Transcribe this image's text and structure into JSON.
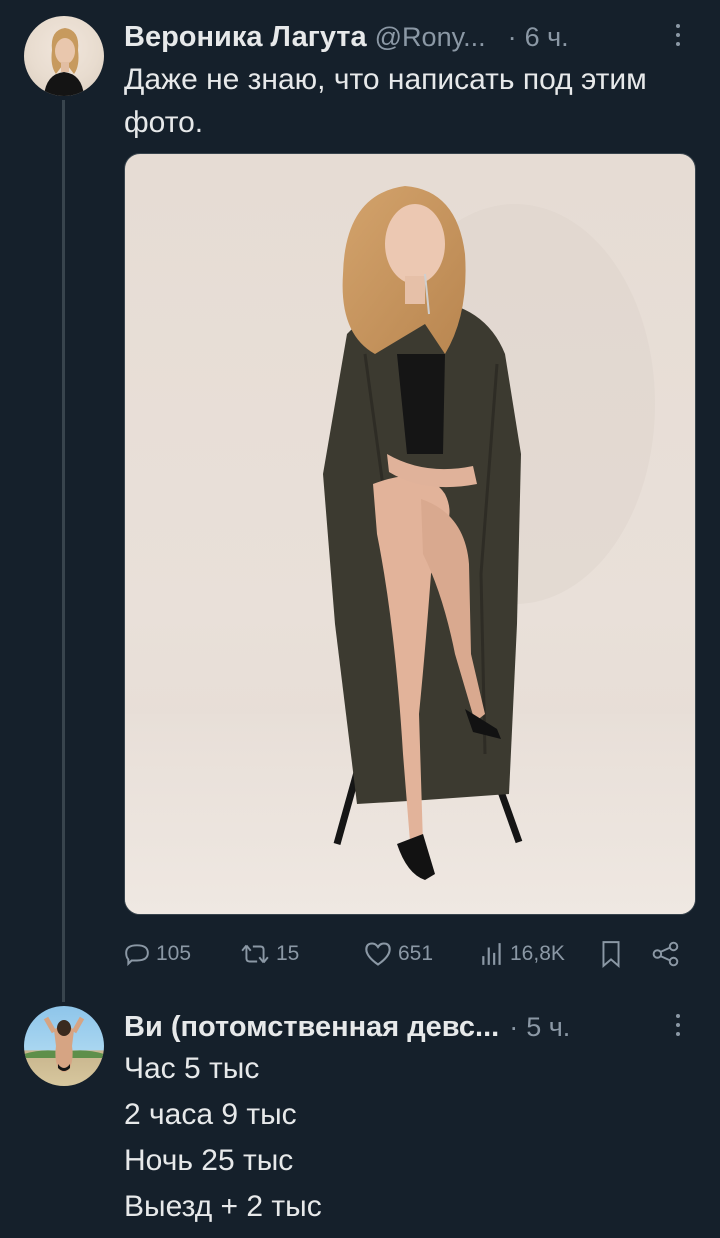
{
  "tweets": [
    {
      "author_name": "Вероника Лагута",
      "handle": "@Rony...",
      "separator": "·",
      "time": "6 ч.",
      "text": "Даже не знаю, что написать под этим фото.",
      "has_photo": true,
      "stats": {
        "replies": "105",
        "retweets": "15",
        "likes": "651",
        "views": "16,8K"
      }
    },
    {
      "author_name": "Ви (потомственная девс...",
      "separator": "·",
      "time": "5 ч.",
      "lines": [
        "Час 5 тыс",
        "2 часа 9 тыс",
        "Ночь 25 тыс",
        "Выезд + 2 тыс"
      ]
    }
  ],
  "icons": {
    "reply": "reply-icon",
    "retweet": "retweet-icon",
    "like": "heart-icon",
    "views": "views-icon",
    "bookmark": "bookmark-icon",
    "share": "share-icon",
    "more": "more-vertical-icon"
  },
  "colors": {
    "background": "#15202b",
    "text": "#e7e9ea",
    "secondary": "#8b98a5",
    "thread_line": "#38444d"
  }
}
